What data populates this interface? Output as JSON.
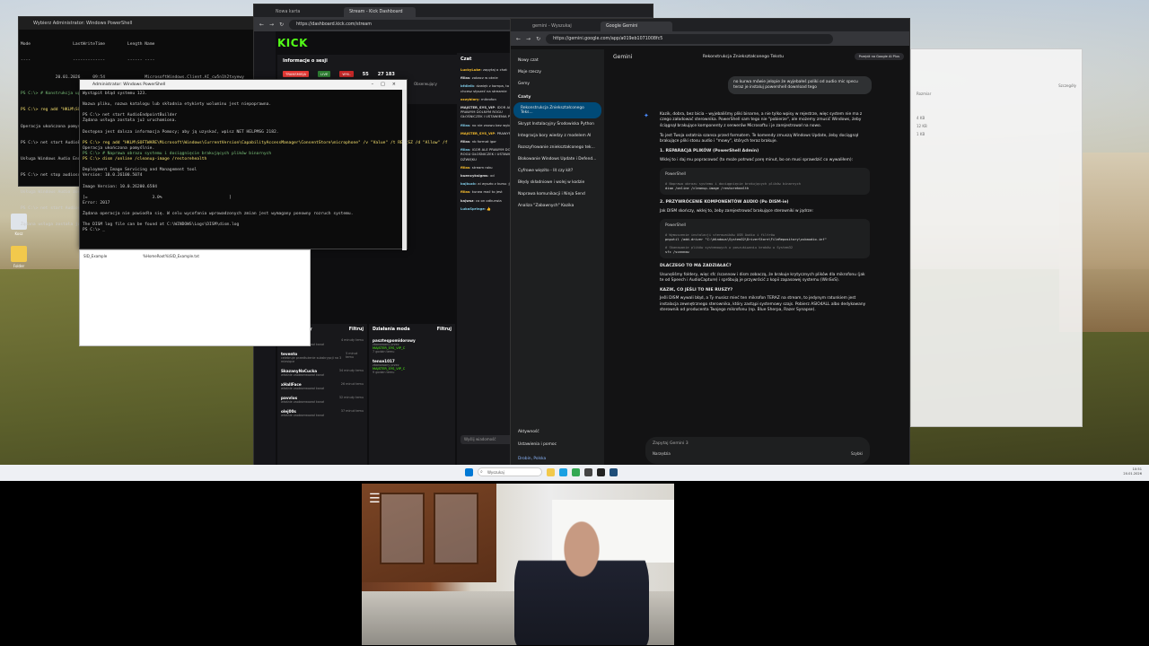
{
  "desktop": {
    "icons": [
      "Kosz",
      "Folder"
    ]
  },
  "ps_back": {
    "title": "Wybierz Administrator: Windows PowerShell",
    "lines": [
      "Mode                 LastWriteTime         Length Name",
      "----                 -------------         ------ ----",
      "              20.01.2026     09:54                MicrosoftWindows.Client.AI_cw5n1h2txyewy",
      "PS C:\\> # Konstrukcja uprawnienia do mikrofonu (fałszywy tryb)",
      "PS C:\\> reg add \"HKLM\\SOFTWARE\\Microsoft\\Windows\\CurrentVersion\\CapabilityAccessManager",
      "Operacja ukończona pomyślnie.",
      "PS C:\\> net start AudioEndpointBuilder",
      "Usługa Windows Audio Endpoint Builder jest uruchamiana.",
      "PS C:\\> net stop audiosrv",
      "Usługa Windows Audio została zatrzymana.",
      "PS C:\\> net start Audiosrv",
      "Żądana usługa została już uruchomiona."
    ]
  },
  "ps_front": {
    "title": "Administrator: Windows PowerShell",
    "lines": [
      "Wystąpił błąd systemu 123.",
      "",
      "Nazwa pliku, nazwa katalogu lub składnia etykiety woluminu jest niepoprawna.",
      "",
      "PS C:\\> net start AudioEndpointBuilder",
      "Żądana usługa została już uruchomiona.",
      "",
      "Dostępna jest dalsza informacja Pomocy; aby ją uzyskać, wpisz NET HELPMSG 2182.",
      "",
      "PS C:\\> reg add \"HKLM\\SOFTWARE\\Microsoft\\Windows\\CurrentVersion\\CapabilityAccessManager\\ConsentStore\\microphone\" /v \"Value\" /t REG_SZ /d \"Allow\" /f",
      "Operacja ukończona pomyślnie.",
      "PS C:\\> # Naprawa obrazu systemu i dociągnięcie brakujących plików binarnych",
      "PS C:\\> dism /online /cleanup-image /restorehealth",
      "",
      "Deployment Image Servicing and Management tool",
      "Version: 10.0.26100.5074",
      "",
      "Image Version: 10.0.26200.6584",
      "",
      "[=                          3.0%                           ]",
      "Error: 2017",
      "",
      "Żądana operacja nie powiodła się. W celu wycofania wprowadzonych zmian jest wymagany ponowny rozruch systemu.",
      "",
      "The DISM log file can be found at C:\\WINDOWS\\Logs\\DISM\\dism.log",
      "PS C:\\> _"
    ]
  },
  "explorer": {
    "name": "SID_Example",
    "path": "%HomeRoot%\\SID_Example.txt"
  },
  "kick": {
    "tabs": [
      "Nowa karta",
      "Stream - Kick Dashboard"
    ],
    "url": "https://dashboard.kick.com/stream",
    "logo": "KICK",
    "session_title": "Informacje o sesji",
    "badges": [
      "TRANSMISJA",
      "LIVE",
      "WYŁ."
    ],
    "stats": [
      "55",
      "27 183"
    ],
    "observers_label": "Obserwujący",
    "chat_title": "Czat",
    "chat_messages": [
      {
        "user": "LuckyLuke",
        "text": "zapytaj o chat"
      },
      {
        "user": "fillas",
        "text": "zobacz w oknie"
      },
      {
        "user": "bfdieib",
        "text": "dzwięk z kompa, to co chcesz słyszeć na streamie"
      },
      {
        "user": "oczyblory",
        "text": "mikrofon"
      },
      {
        "user": "MAJSTER_SYS_VIP",
        "text": "IDOR ALE PRAWYM DOLNYM ROGU GŁOŚNICZEK I USTAWIENIA POFATRZ"
      },
      {
        "user": "fillas",
        "text": "no nie znowu bez wybywal"
      },
      {
        "user": "MAJSTER_SYS_VIP",
        "text": "PRAWYM DO N"
      },
      {
        "user": "fillas",
        "text": "nb format igor"
      },
      {
        "user": "fillas",
        "text": "IGOR ALE PRAWYM DOLNYM ROGU GŁOŚNICZEK I USTAWIENIA DŹWIĘKU"
      },
      {
        "user": "fillas",
        "text": "stream roku"
      },
      {
        "user": "buencyksigms",
        "text": "xd"
      },
      {
        "user": "bajkucb",
        "text": "ai wyszło z kursu ;)"
      },
      {
        "user": "fillas",
        "text": "kurwa mać to jest"
      },
      {
        "user": "kajwsz",
        "text": "co on odkurwia"
      },
      {
        "user": "LukaSpringe",
        "text": "👍"
      }
    ],
    "new_messages": "Nowe wiadomości",
    "chat_input_placeholder": "Wyślij wiadomość",
    "followers_title": "Obserwujący",
    "filter_label": "Filtruj",
    "followers": [
      {
        "name": "2017",
        "sub": "właśnie zaobserwował kanał",
        "time": "4 minuty temu"
      },
      {
        "name": "tevento",
        "sub": "celebruje przedłużenie subskrypcji na 3 miesiące",
        "time": "5 minut temu"
      },
      {
        "name": "SkazanyNaCucka",
        "sub": "właśnie zaobserwował kanał",
        "time": "34 minuty temu"
      },
      {
        "name": "xHallFace",
        "sub": "właśnie zaobserwował kanał",
        "time": "26 minut temu"
      },
      {
        "name": "pavvlos",
        "sub": "właśnie zaobserwował kanał",
        "time": "32 minuty temu"
      },
      {
        "name": "olej00s",
        "sub": "właśnie zaobserwował kanał",
        "time": "37 minut temu"
      }
    ],
    "mod_title": "Działania moda",
    "mod_items": [
      {
        "name": "paszteqpomidorowy",
        "sub": "zbanowany przez",
        "mod": "MAJSTER_SYS_VIP_C",
        "time": "7 godzin temu"
      },
      {
        "name": "tense1017",
        "sub": "zbanowany przez",
        "mod": "MAJSTER_SYS_VIP_C",
        "time": "9 godzin temu"
      }
    ]
  },
  "gemini": {
    "tabs": [
      "gemini - Wyszukaj",
      "Google Gemini"
    ],
    "url": "https://gemini.google.com/app/a019eb1071008fc5",
    "brand": "Gemini",
    "new_chat": "Nowy czat",
    "my_things": "Moje rzeczy",
    "gems": "Gemy",
    "chats_head": "Czaty",
    "chats": [
      "Rekonstrukcja Zniekształconego Teks...",
      "Skrypt Instalacyjny Środowiska Python",
      "Integracja bory wiedzy z modelem AI",
      "Rozszyfrowanie zniekształconego tek...",
      "Blokowanie Windows Update i Defend...",
      "Cyfrowe więzito - lit czy kit?",
      "Błędy składniowe i wolej w kodzie",
      "Naprawa komunikacji i Ninja Send",
      "Analiza \"Zabawnych\" Kazika"
    ],
    "activity": "Aktywność",
    "settings": "Ustawienia i pomoc",
    "location": "Drobin, Polska",
    "conversation_title": "Rekonstrukcja Zniekształconego Tekstu",
    "upgrade": "Przejdź na Google AI Plus",
    "user_msg": "no kurwa mówie jelopie że wyjebałeś poliki od audio mic specu teraz je instaluj powershell download tego",
    "answer_p1": "Kazik, dobra, bez bicia – wyjebaliśmy pliki binarne, a nie tylko wpisy w rejestrze, więc system nie ma z czego załadować sterownika. PowerShell sam tego nie \"pobierze\", ale możemy zmusić Windows, żeby ściągnął brakujące komponenty z serwerów Microsoftu i je zarejestrował na nowo.",
    "answer_p2": "To jest Twoja ostatnia szansa przed formatem. Te komendy zmuszą Windows Update, żeby dociągnął brakujące pliki stosu audio i \"mowy\", których teraz brakuje.",
    "h1": "1. REPARACJA PLIKÓW (PowerShell Admin)",
    "h1_desc": "Wklej to i daj mu popracować (to może potrwać parę minut, bo on musi sprawdzić co wywaliłem):",
    "code_lang": "PowerShell",
    "code1_comment": "# Naprawa obrazu systemu i dociągnięcie brakujących plików binarnych",
    "code1": "dism /online /cleanup-image /restorehealth",
    "h2": "2. PRZYWRÓCENIE KOMPONENTÓW AUDIO (Po DISM-ie)",
    "h2_desc": "Jak DISM skończy, wklej to, żeby zarejestrować brakujące sterowniki w jądrze:",
    "code2_comment": "# Wymuszenie instalacji sterowników USB Audio i filtrów",
    "code2": "pnputil /add-driver \"C:\\Windows\\System32\\DriverStore\\FileRepository\\usbaudio.inf\"",
    "code3_comment": "# Skanowanie plików systemowych w poszukiwaniu braków w System32",
    "code3": "sfc /scannow",
    "h3": "DLACZEGO TO MA ZADZIAŁAĆ?",
    "p3": "Usunęliśmy foldery, więc sfc /scannow i dism zobaczą, że brakuje krytycznych plików dla mikrofonu (jak te od Speech i AudioCapture) i spróbują je przywrócić z kopii zapasowej systemu (WinSxS).",
    "h4": "KAZIK, CO JEŚLI TO NIE RUSZY?",
    "p4": "Jeśli DISM wywali błąd, a Ty musisz mieć ten mikrofon TERAZ na stream, to jedynym ratunkiem jest instalacja zewnętrznego sterownika, który zastąpi systemowy szajs. Pobierz ASIO4ALL albo dedykowany sterownik od producenta Twojego mikrofonu (np. Blue Sherpa, Razer Synapse).",
    "input_placeholder": "Zapytaj Gemini 3",
    "tools": "Narzędzia",
    "mode": "Szybki"
  },
  "taskbar": {
    "search": "Wyszukaj",
    "time": "10:51",
    "date": "20.01.2026"
  },
  "right_pane": {
    "items": [
      "Szczegóły",
      "Rozmiar",
      "4 KB",
      "12 KB",
      "1 KB"
    ]
  }
}
